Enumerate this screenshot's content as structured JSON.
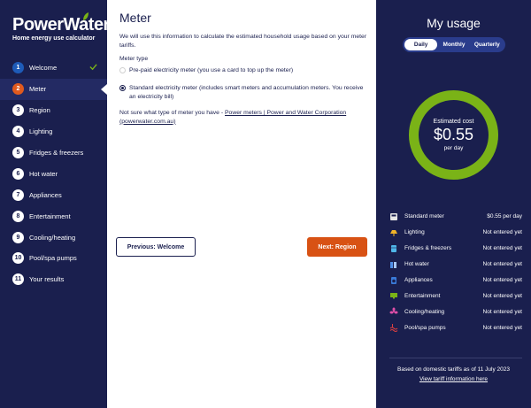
{
  "brand": {
    "name": "PowerWater",
    "subtitle": "Home energy use calculator"
  },
  "nav": [
    {
      "num": "1",
      "label": "Welcome",
      "state": "done"
    },
    {
      "num": "2",
      "label": "Meter",
      "state": "current"
    },
    {
      "num": "3",
      "label": "Region",
      "state": "todo"
    },
    {
      "num": "4",
      "label": "Lighting",
      "state": "todo"
    },
    {
      "num": "5",
      "label": "Fridges & freezers",
      "state": "todo"
    },
    {
      "num": "6",
      "label": "Hot water",
      "state": "todo"
    },
    {
      "num": "7",
      "label": "Appliances",
      "state": "todo"
    },
    {
      "num": "8",
      "label": "Entertainment",
      "state": "todo"
    },
    {
      "num": "9",
      "label": "Cooling/heating",
      "state": "todo"
    },
    {
      "num": "10",
      "label": "Pool/spa pumps",
      "state": "todo"
    },
    {
      "num": "11",
      "label": "Your results",
      "state": "todo"
    }
  ],
  "main": {
    "title": "Meter",
    "intro": "We will use this information to calculate the estimated household usage based on your meter tariffs.",
    "meter_type_label": "Meter type",
    "options": [
      {
        "label": "Pre-paid electricity meter (you use a card to top up the meter)",
        "checked": false
      },
      {
        "label": "Standard electricity meter (includes smart meters and accumulation meters. You receive an electricity bill)",
        "checked": true
      }
    ],
    "not_sure_prefix": "Not sure what type of meter you have - ",
    "not_sure_link": "Power meters | Power and Water Corporation (powerwater.com.au)",
    "prev_button": "Previous: Welcome",
    "next_button": "Next: Region"
  },
  "usage": {
    "title": "My usage",
    "tabs": [
      "Daily",
      "Monthly",
      "Quarterly"
    ],
    "active_tab": "Daily",
    "gauge": {
      "label": "Estimated cost",
      "value": "$0.55",
      "sub": "per day",
      "fill": 1.0,
      "color": "#7ab317"
    },
    "rows": [
      {
        "icon": "meter-icon",
        "name": "Standard meter",
        "value": "$0.55 per day"
      },
      {
        "icon": "lamp-icon",
        "name": "Lighting",
        "value": "Not entered yet"
      },
      {
        "icon": "fridge-icon",
        "name": "Fridges & freezers",
        "value": "Not entered yet"
      },
      {
        "icon": "shower-icon",
        "name": "Hot water",
        "value": "Not entered yet"
      },
      {
        "icon": "appliance-icon",
        "name": "Appliances",
        "value": "Not entered yet"
      },
      {
        "icon": "tv-icon",
        "name": "Entertainment",
        "value": "Not entered yet"
      },
      {
        "icon": "fan-icon",
        "name": "Cooling/heating",
        "value": "Not entered yet"
      },
      {
        "icon": "pool-icon",
        "name": "Pool/spa pumps",
        "value": "Not entered yet"
      }
    ],
    "footer_note": "Based on domestic tariffs as of 11 July 2023",
    "footer_link": "View tariff information here"
  }
}
